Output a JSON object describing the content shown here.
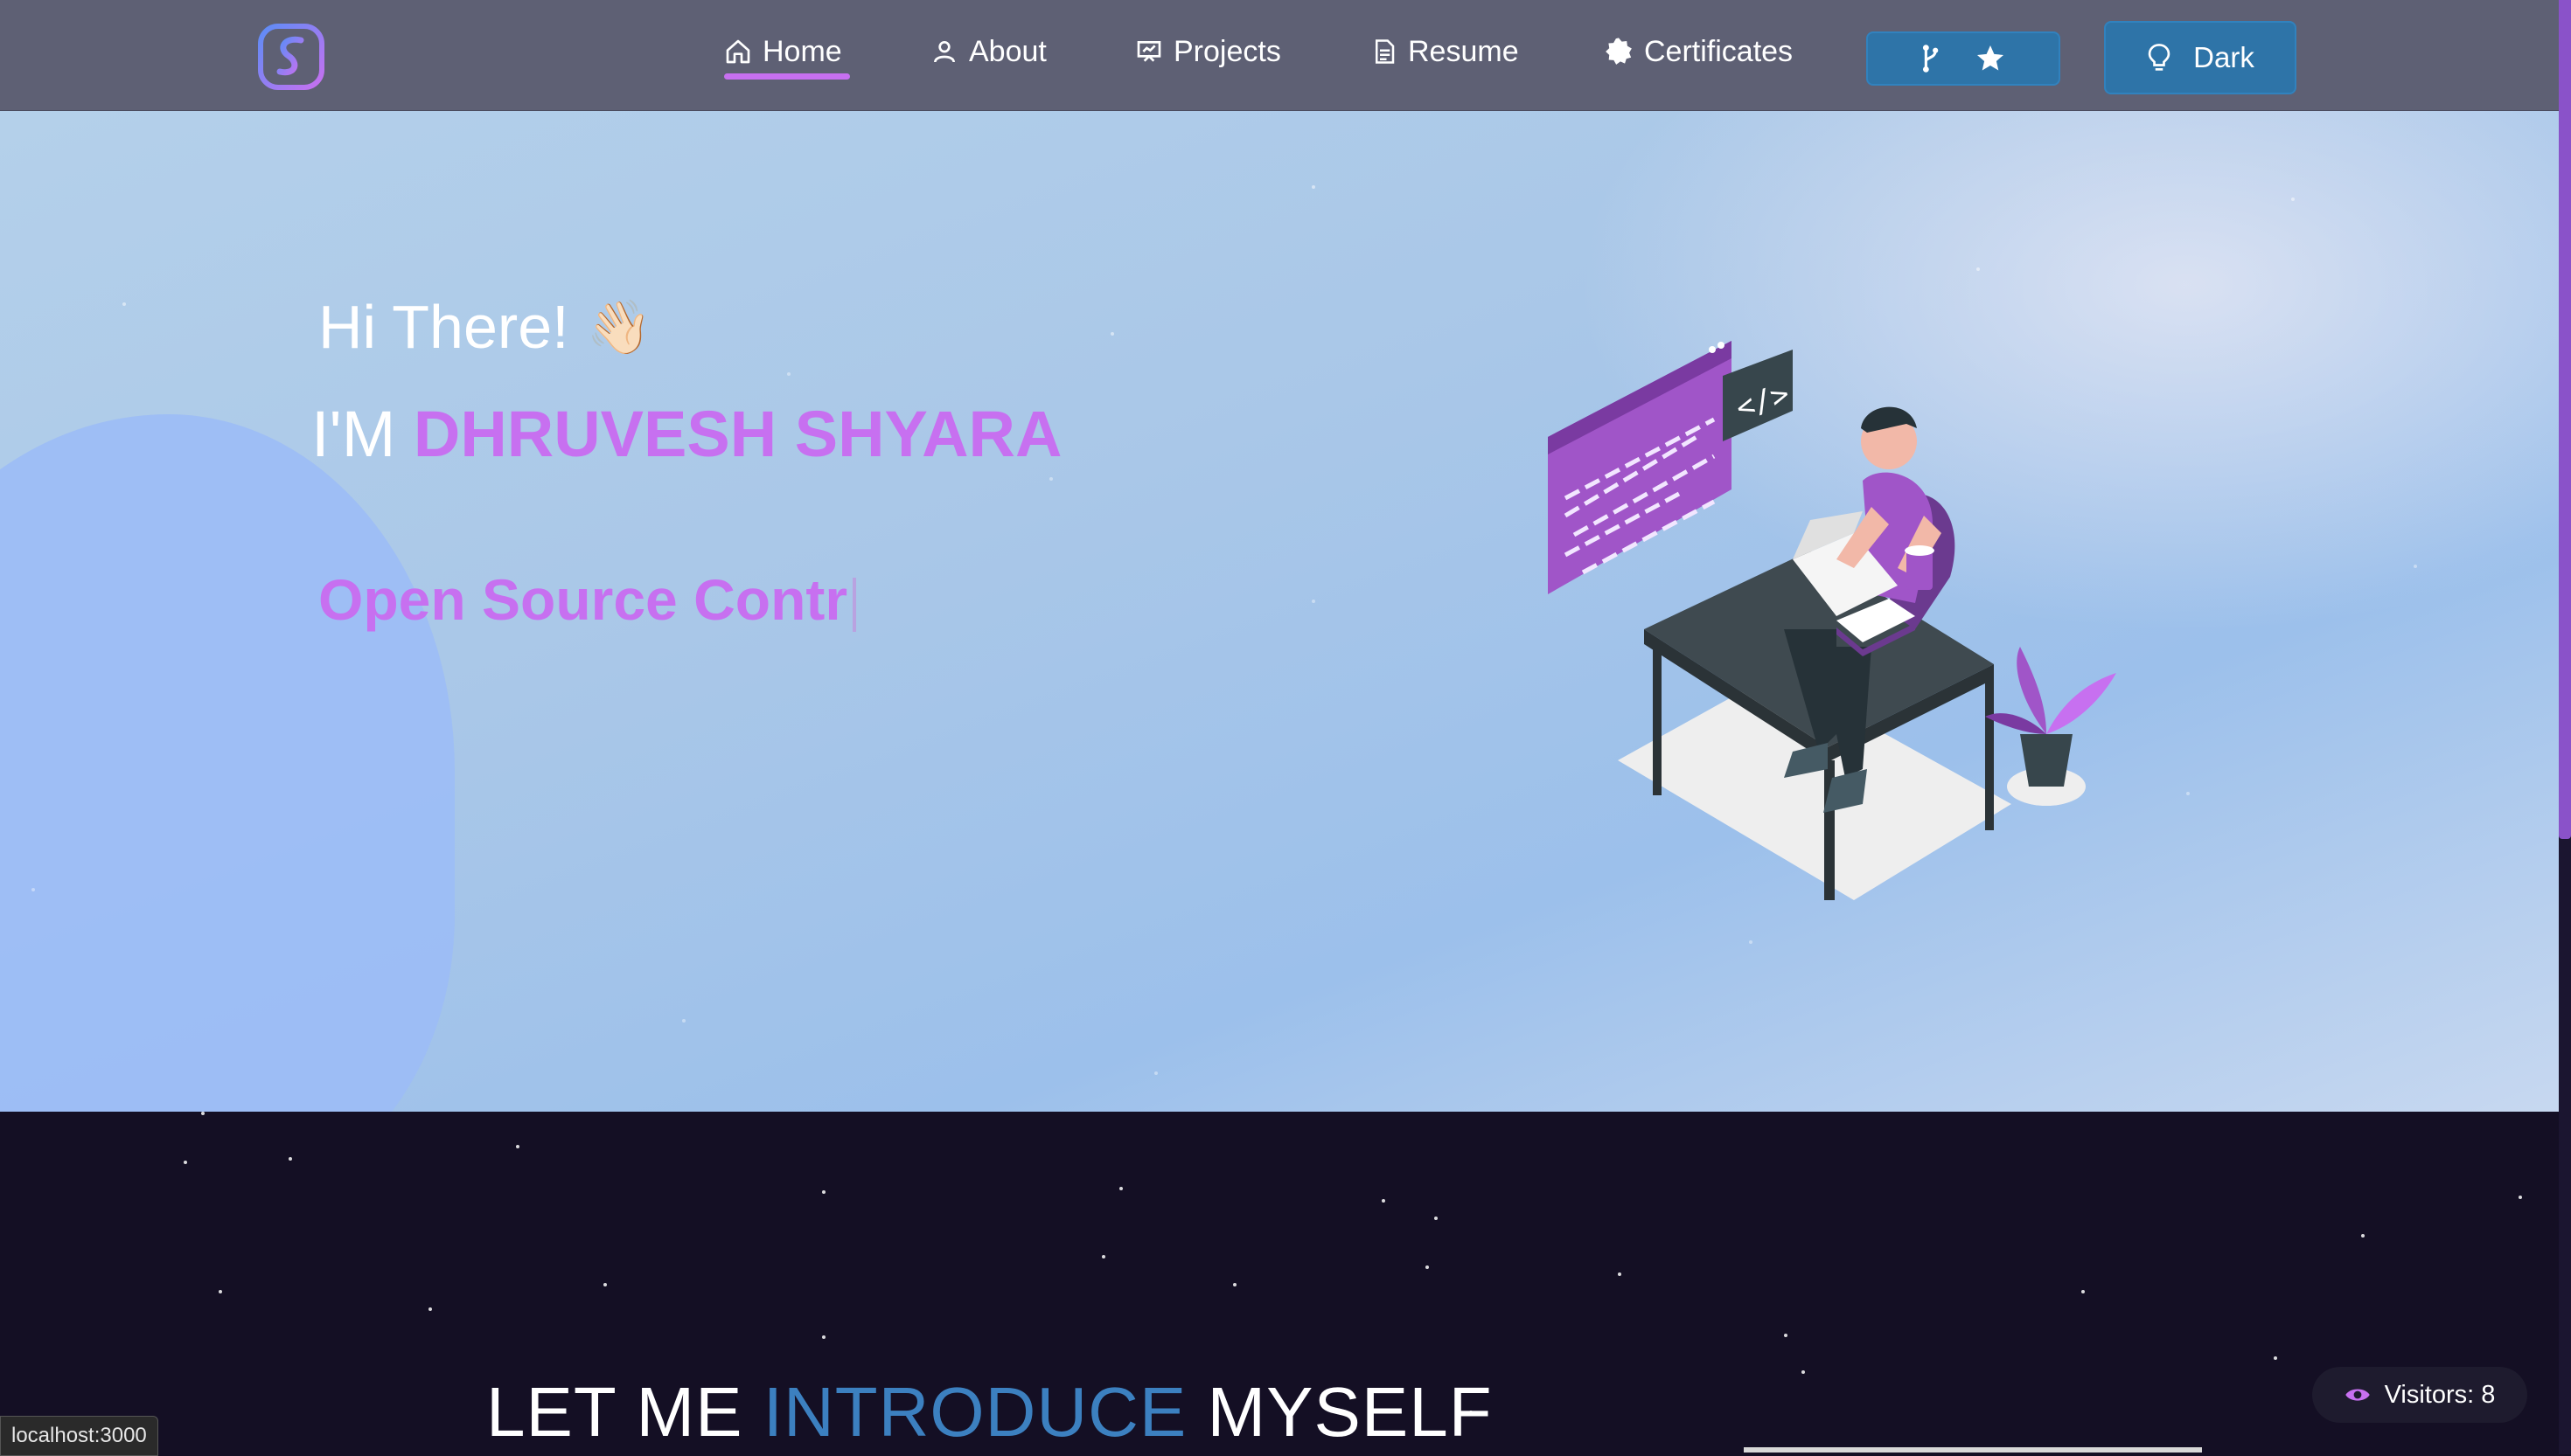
{
  "nav": {
    "items": [
      {
        "label": "Home",
        "icon": "home-icon"
      },
      {
        "label": "About",
        "icon": "user-icon"
      },
      {
        "label": "Projects",
        "icon": "presentation-icon"
      },
      {
        "label": "Resume",
        "icon": "document-icon"
      },
      {
        "label": "Certificates",
        "icon": "badge-icon"
      }
    ],
    "active": "Home",
    "fork_icon": "git-fork-icon",
    "star_icon": "star-icon",
    "theme_label": "Dark",
    "theme_icon": "lightbulb-icon"
  },
  "hero": {
    "greeting": "Hi There!",
    "wave_emoji": "👋🏻",
    "prefix": "I'M",
    "name": "DHRUVESH SHYARA",
    "typed_text": "Open Source Contr"
  },
  "about": {
    "heading_start": "LET ME",
    "heading_accent": "INTRODUCE",
    "heading_end": "MYSELF"
  },
  "visitors": {
    "label": "Visitors: 8",
    "icon": "eye-icon"
  },
  "status_bar": {
    "url": "localhost:3000"
  },
  "colors": {
    "accent_purple": "#c770f0",
    "accent_blue": "#3c80c0",
    "button_blue": "#2e74a8",
    "navbar": "#5e6074",
    "dark_bg": "#140f24"
  }
}
